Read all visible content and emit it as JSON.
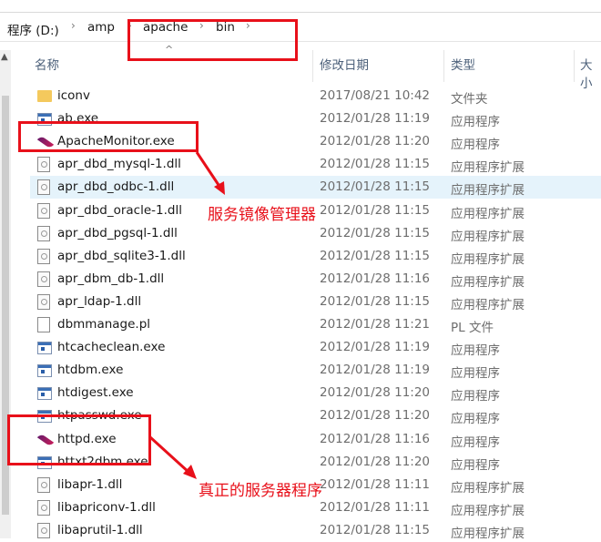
{
  "breadcrumb": [
    "程序 (D:)",
    "amp",
    "apache",
    "bin"
  ],
  "columns": {
    "name": "名称",
    "date": "修改日期",
    "type": "类型",
    "size": "大小"
  },
  "files": [
    {
      "name": "iconv",
      "date": "2017/08/21 10:42",
      "type": "文件夹",
      "icon": "folder"
    },
    {
      "name": "ab.exe",
      "date": "2012/01/28 11:19",
      "type": "应用程序",
      "icon": "exe"
    },
    {
      "name": "ApacheMonitor.exe",
      "date": "2012/01/28 11:20",
      "type": "应用程序",
      "icon": "feather"
    },
    {
      "name": "apr_dbd_mysql-1.dll",
      "date": "2012/01/28 11:15",
      "type": "应用程序扩展",
      "icon": "dll"
    },
    {
      "name": "apr_dbd_odbc-1.dll",
      "date": "2012/01/28 11:15",
      "type": "应用程序扩展",
      "icon": "dll",
      "selected": true
    },
    {
      "name": "apr_dbd_oracle-1.dll",
      "date": "2012/01/28 11:15",
      "type": "应用程序扩展",
      "icon": "dll"
    },
    {
      "name": "apr_dbd_pgsql-1.dll",
      "date": "2012/01/28 11:15",
      "type": "应用程序扩展",
      "icon": "dll"
    },
    {
      "name": "apr_dbd_sqlite3-1.dll",
      "date": "2012/01/28 11:15",
      "type": "应用程序扩展",
      "icon": "dll"
    },
    {
      "name": "apr_dbm_db-1.dll",
      "date": "2012/01/28 11:16",
      "type": "应用程序扩展",
      "icon": "dll"
    },
    {
      "name": "apr_ldap-1.dll",
      "date": "2012/01/28 11:15",
      "type": "应用程序扩展",
      "icon": "dll"
    },
    {
      "name": "dbmmanage.pl",
      "date": "2012/01/28 11:21",
      "type": "PL 文件",
      "icon": "file"
    },
    {
      "name": "htcacheclean.exe",
      "date": "2012/01/28 11:19",
      "type": "应用程序",
      "icon": "exe"
    },
    {
      "name": "htdbm.exe",
      "date": "2012/01/28 11:19",
      "type": "应用程序",
      "icon": "exe"
    },
    {
      "name": "htdigest.exe",
      "date": "2012/01/28 11:20",
      "type": "应用程序",
      "icon": "exe"
    },
    {
      "name": "htpasswd.exe",
      "date": "2012/01/28 11:20",
      "type": "应用程序",
      "icon": "exe"
    },
    {
      "name": "httpd.exe",
      "date": "2012/01/28 11:16",
      "type": "应用程序",
      "icon": "feather"
    },
    {
      "name": "httxt2dbm.exe",
      "date": "2012/01/28 11:20",
      "type": "应用程序",
      "icon": "exe"
    },
    {
      "name": "libapr-1.dll",
      "date": "2012/01/28 11:11",
      "type": "应用程序扩展",
      "icon": "dll"
    },
    {
      "name": "libapriconv-1.dll",
      "date": "2012/01/28 11:11",
      "type": "应用程序扩展",
      "icon": "dll"
    },
    {
      "name": "libaprutil-1.dll",
      "date": "2012/01/28 11:15",
      "type": "应用程序扩展",
      "icon": "dll"
    }
  ],
  "annotations": {
    "monitor": "服务镜像管理器",
    "httpd": "真正的服务器程序"
  },
  "colors": {
    "annotation": "#e8101a",
    "selection": "#e5f3fb"
  }
}
